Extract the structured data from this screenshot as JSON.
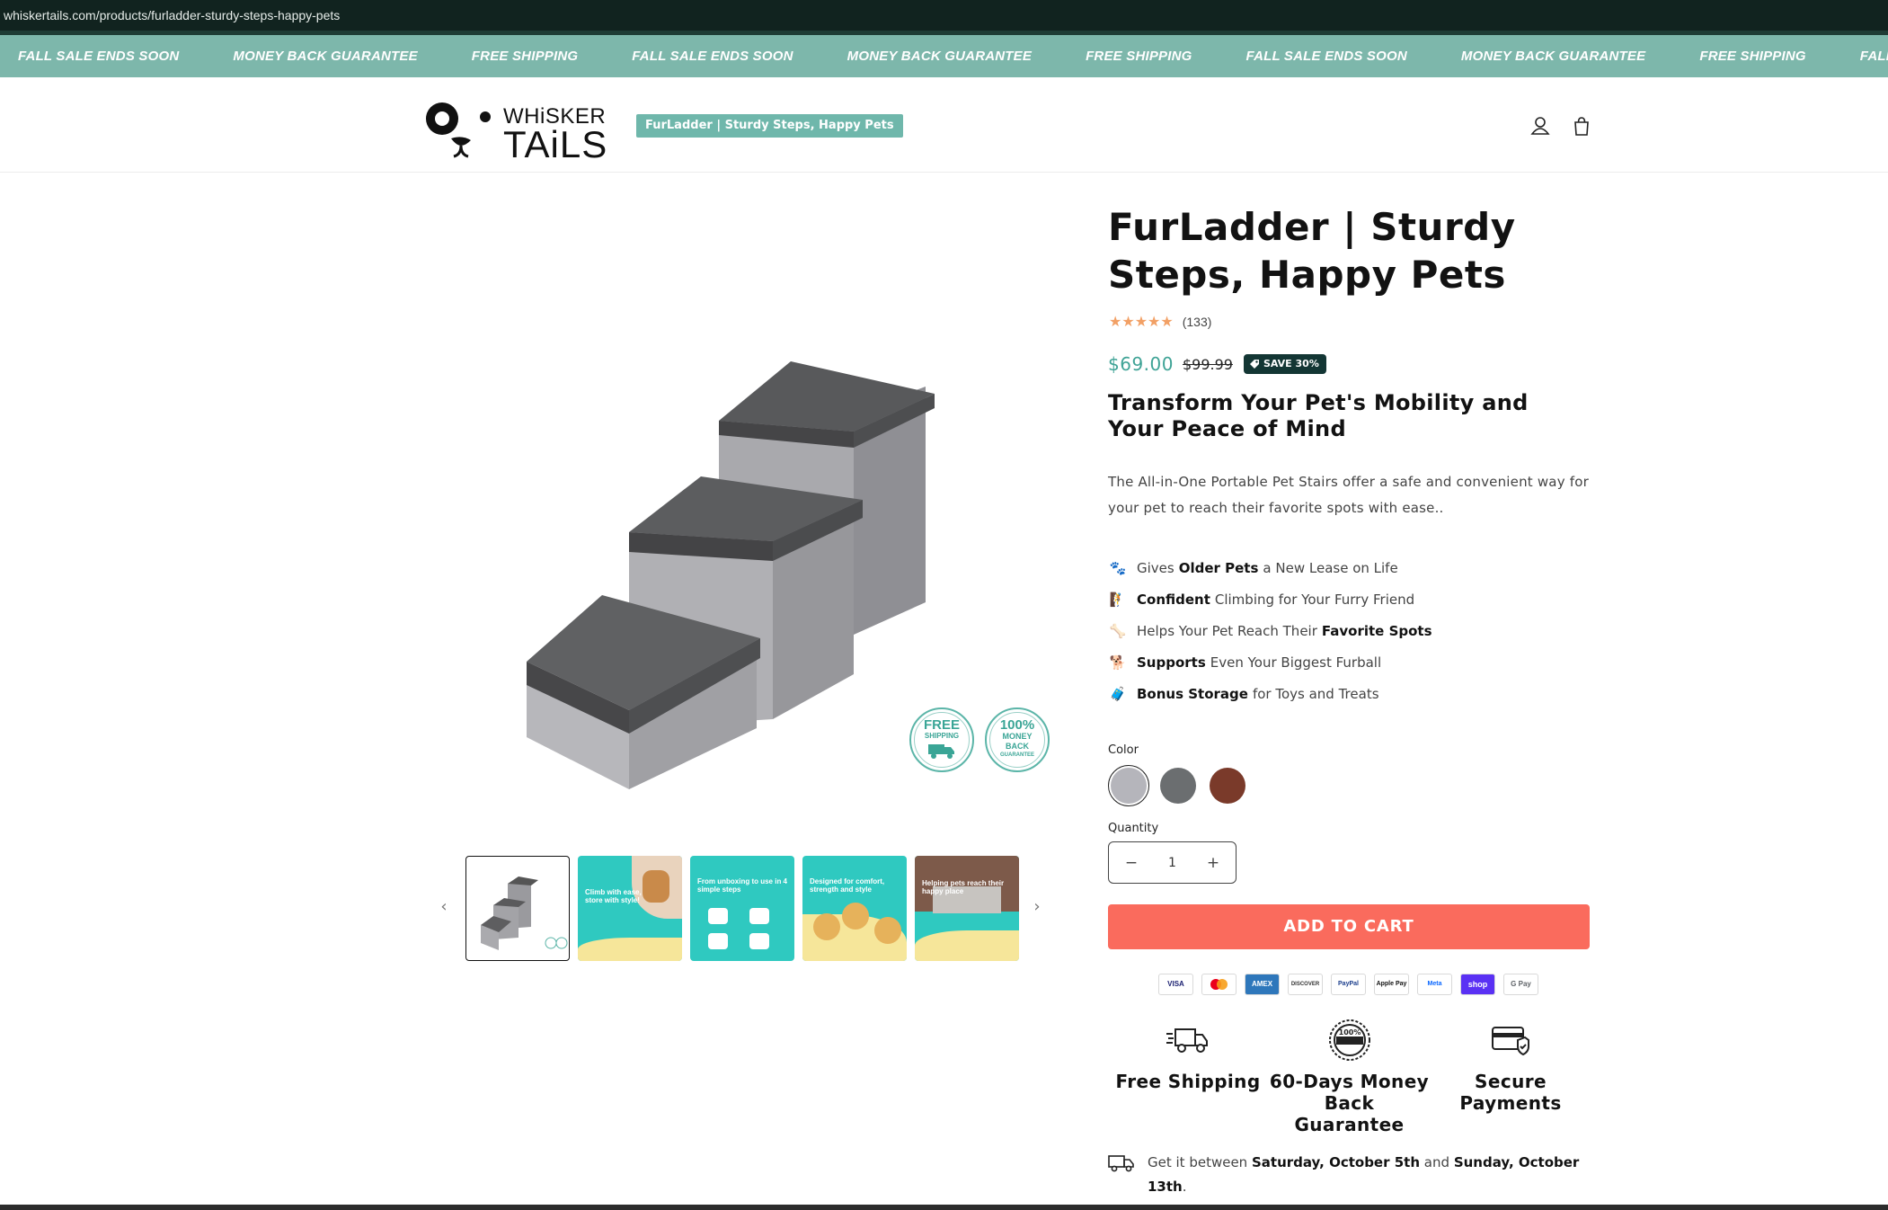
{
  "browser": {
    "url": "whiskertails.com/products/furladder-sturdy-steps-happy-pets"
  },
  "announcement": {
    "items": [
      "FALL SALE ENDS SOON",
      "MONEY BACK GUARANTEE",
      "FREE SHIPPING",
      "FALL SALE ENDS SOON",
      "MONEY BACK GUARANTEE",
      "FREE SHIPPING",
      "FALL SALE ENDS SOON",
      "MONEY BACK GUARANTEE",
      "FREE SHIPPING",
      "FALL SALE ENDS SOON"
    ]
  },
  "header": {
    "logo": {
      "line1": "WHiSKER",
      "line2": "TAiLS"
    },
    "badge": "FurLadder | Sturdy Steps, Happy Pets",
    "icons": [
      "account-icon",
      "cart-icon"
    ]
  },
  "gallery": {
    "badges": [
      {
        "line1": "FREE",
        "line2": "SHIPPING"
      },
      {
        "line1": "100%",
        "line2": "MONEY",
        "line3": "BACK",
        "line4": "GUARANTEE"
      }
    ],
    "thumbnails": [
      {
        "caption": ""
      },
      {
        "caption": "Climb with ease, store with style!"
      },
      {
        "caption": "From unboxing to use in 4 simple steps"
      },
      {
        "caption": "Designed for comfort, strength and style"
      },
      {
        "caption": "Helping pets reach their happy place"
      }
    ],
    "prev_arrow": "‹",
    "next_arrow": "›"
  },
  "product": {
    "title": "FurLadder | Sturdy Steps, Happy Pets",
    "stars": "★★★★★",
    "review_count": "(133)",
    "price": "$69.00",
    "compare_price": "$99.99",
    "save_badge": "SAVE 30%",
    "subtitle": "Transform Your Pet's Mobility and Your Peace of Mind",
    "description": "The All-in-One Portable Pet Stairs offer a safe and convenient way for your pet to reach their favorite spots with ease..",
    "features": [
      {
        "icon": "🐾",
        "pre": "Gives",
        "bold": "Older Pets",
        "post": "a New Lease on Life"
      },
      {
        "icon": "🧗",
        "pre": "",
        "bold": "Confident",
        "post": "Climbing for Your Furry Friend"
      },
      {
        "icon": "🦴",
        "pre": "Helps Your Pet Reach Their",
        "bold": "Favorite Spots",
        "post": ""
      },
      {
        "icon": "🐕",
        "pre": "",
        "bold": "Supports",
        "post": "Even Your Biggest Furball"
      },
      {
        "icon": "🧳",
        "pre": "",
        "bold": "Bonus Storage",
        "post": "for Toys and Treats"
      }
    ],
    "color_label": "Color",
    "colors": [
      {
        "name": "Light Gray",
        "hex": "#b5b5bb",
        "selected": true
      },
      {
        "name": "Dark Gray",
        "hex": "#6b6e70",
        "selected": false
      },
      {
        "name": "Brown",
        "hex": "#7a3a2a",
        "selected": false
      }
    ],
    "quantity_label": "Quantity",
    "quantity": "1",
    "qty_minus": "−",
    "qty_plus": "+",
    "add_to_cart": "ADD TO CART",
    "payments": [
      "VISA",
      "MC",
      "AMEX",
      "DISCOVER",
      "PayPal",
      "Apple Pay",
      "Meta",
      "shop",
      "G Pay"
    ],
    "trust": [
      {
        "icon": "truck-icon",
        "label": "Free Shipping"
      },
      {
        "icon": "guarantee-seal-icon",
        "label": "60-Days Money Back Guarantee"
      },
      {
        "icon": "secure-card-icon",
        "label": "Secure Payments"
      }
    ],
    "delivery": {
      "pre": "Get it between",
      "start": "Saturday, October 5th",
      "mid": "and",
      "end": "Sunday, October 13th",
      "post": "."
    }
  },
  "colors": {
    "accent": "#7db7ab",
    "cta": "#fa6b5d",
    "price": "#3fa396",
    "dark": "#133634"
  }
}
